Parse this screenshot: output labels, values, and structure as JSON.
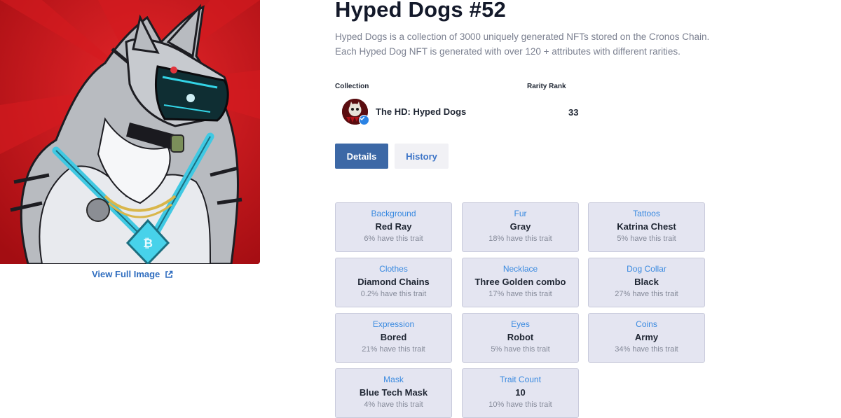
{
  "nft": {
    "title": "Hyped Dogs #52",
    "description": "Hyped Dogs is a collection of 3000 uniquely generated NFTs stored on the Cronos Chain. Each Hyped Dog NFT is generated with over 120 + attributes with different rarities.",
    "view_full_image": "View Full Image"
  },
  "meta": {
    "collection_label": "Collection",
    "collection_name": "The HD: Hyped Dogs",
    "rarity_label": "Rarity Rank",
    "rarity_value": "33"
  },
  "tabs": {
    "details": "Details",
    "history": "History"
  },
  "traits": [
    {
      "name": "Background",
      "value": "Red Ray",
      "pct": "6% have this trait"
    },
    {
      "name": "Fur",
      "value": "Gray",
      "pct": "18% have this trait"
    },
    {
      "name": "Tattoos",
      "value": "Katrina Chest",
      "pct": "5% have this trait"
    },
    {
      "name": "Clothes",
      "value": "Diamond Chains",
      "pct": "0.2% have this trait"
    },
    {
      "name": "Necklace",
      "value": "Three Golden combo",
      "pct": "17% have this trait"
    },
    {
      "name": "Dog Collar",
      "value": "Black",
      "pct": "27% have this trait"
    },
    {
      "name": "Expression",
      "value": "Bored",
      "pct": "21% have this trait"
    },
    {
      "name": "Eyes",
      "value": "Robot",
      "pct": "5% have this trait"
    },
    {
      "name": "Coins",
      "value": "Army",
      "pct": "34% have this trait"
    },
    {
      "name": "Mask",
      "value": "Blue Tech Mask",
      "pct": "4% have this trait"
    },
    {
      "name": "Trait Count",
      "value": "10",
      "pct": "10% have this trait"
    }
  ],
  "colors": {
    "accent": "#3c68a6",
    "link": "#2f6dbf",
    "trait_name": "#3a8ae0",
    "trait_bg": "#e4e5f1"
  }
}
